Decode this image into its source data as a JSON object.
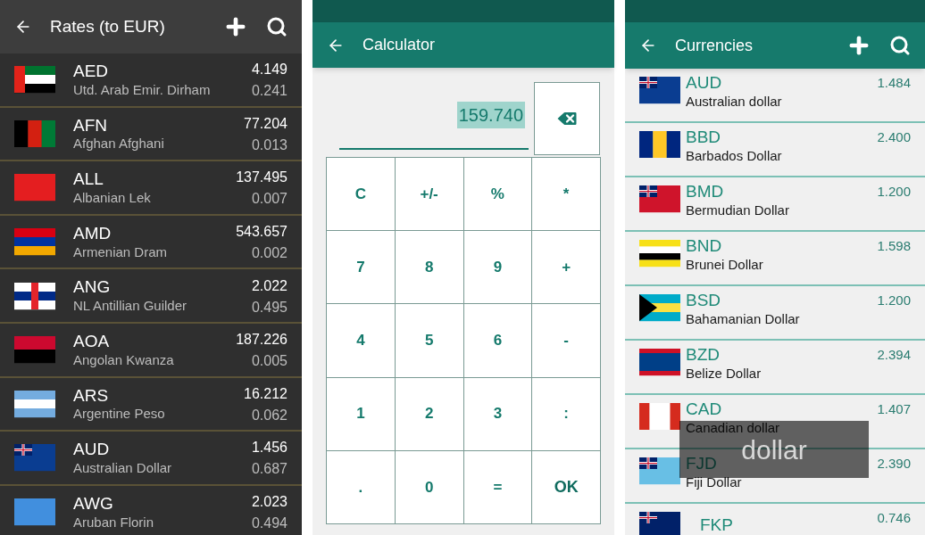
{
  "rates_screen": {
    "title": "Rates (to EUR)",
    "rows": [
      {
        "code": "AED",
        "name": "Utd. Arab Emir. Dirham",
        "rate": "4.149",
        "inverse": "0.241"
      },
      {
        "code": "AFN",
        "name": "Afghan Afghani",
        "rate": "77.204",
        "inverse": "0.013"
      },
      {
        "code": "ALL",
        "name": "Albanian Lek",
        "rate": "137.495",
        "inverse": "0.007"
      },
      {
        "code": "AMD",
        "name": "Armenian Dram",
        "rate": "543.657",
        "inverse": "0.002"
      },
      {
        "code": "ANG",
        "name": "NL Antillian Guilder",
        "rate": "2.022",
        "inverse": "0.495"
      },
      {
        "code": "AOA",
        "name": "Angolan Kwanza",
        "rate": "187.226",
        "inverse": "0.005"
      },
      {
        "code": "ARS",
        "name": "Argentine Peso",
        "rate": "16.212",
        "inverse": "0.062"
      },
      {
        "code": "AUD",
        "name": "Australian Dollar",
        "rate": "1.456",
        "inverse": "0.687"
      },
      {
        "code": "AWG",
        "name": "Aruban Florin",
        "rate": "2.023",
        "inverse": "0.494"
      }
    ]
  },
  "calculator_screen": {
    "title": "Calculator",
    "display": {
      "value": "159.740",
      "highlighted": true
    },
    "keys": [
      {
        "label": "C",
        "kind": "function"
      },
      {
        "label": "+/-",
        "kind": "function"
      },
      {
        "label": "%",
        "kind": "function"
      },
      {
        "label": "*",
        "kind": "operator"
      },
      {
        "label": "7",
        "kind": "digit"
      },
      {
        "label": "8",
        "kind": "digit"
      },
      {
        "label": "9",
        "kind": "digit"
      },
      {
        "label": "+",
        "kind": "operator"
      },
      {
        "label": "4",
        "kind": "digit"
      },
      {
        "label": "5",
        "kind": "digit"
      },
      {
        "label": "6",
        "kind": "digit"
      },
      {
        "label": "-",
        "kind": "operator"
      },
      {
        "label": "1",
        "kind": "digit"
      },
      {
        "label": "2",
        "kind": "digit"
      },
      {
        "label": "3",
        "kind": "digit"
      },
      {
        "label": ":",
        "kind": "operator"
      },
      {
        "label": ".",
        "kind": "digit"
      },
      {
        "label": "0",
        "kind": "digit"
      },
      {
        "label": "=",
        "kind": "operator"
      },
      {
        "label": "OK",
        "kind": "confirm"
      }
    ]
  },
  "currencies_screen": {
    "title": "Currencies",
    "rows": [
      {
        "code": "AUD",
        "name": "Australian dollar",
        "rate": "1.484"
      },
      {
        "code": "BBD",
        "name": "Barbados Dollar",
        "rate": "2.400"
      },
      {
        "code": "BMD",
        "name": "Bermudian Dollar",
        "rate": "1.200"
      },
      {
        "code": "BND",
        "name": "Brunei Dollar",
        "rate": "1.598"
      },
      {
        "code": "BSD",
        "name": "Bahamanian Dollar",
        "rate": "1.200"
      },
      {
        "code": "BZD",
        "name": "Belize Dollar",
        "rate": "2.394"
      },
      {
        "code": "CAD",
        "name": "Canadian dollar",
        "rate": "1.407"
      },
      {
        "code": "FJD",
        "name": "Fiji Dollar",
        "rate": "2.390"
      },
      {
        "code": "FKP",
        "rate": "0.746"
      }
    ],
    "search_popup": "dollar"
  }
}
